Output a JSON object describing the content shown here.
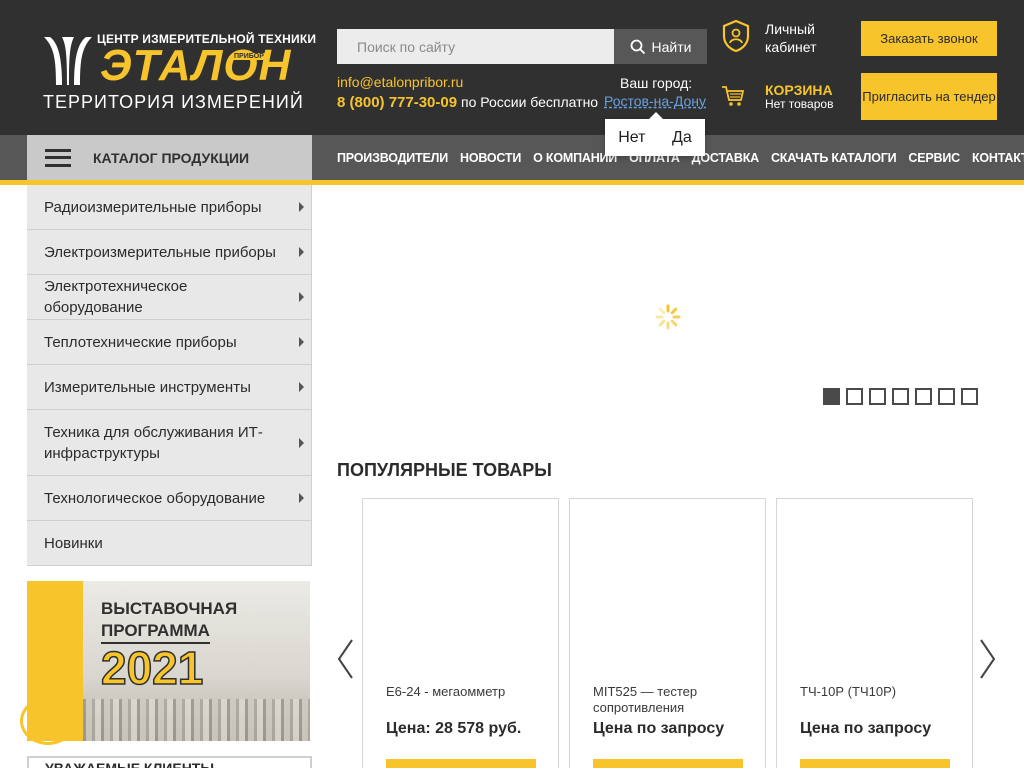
{
  "header": {
    "logo_top": "ЦЕНТР ИЗМЕРИТЕЛЬНОЙ ТЕХНИКИ",
    "logo_main": "ЭТАЛОН",
    "logo_badge": "ПРИБОР",
    "logo_tagline": "ТЕРРИТОРИЯ ИЗМЕРЕНИЙ",
    "search_placeholder": "Поиск по сайту",
    "search_button": "Найти",
    "email": "info@etalonpribor.ru",
    "phone": "8 (800) 777-30-09",
    "phone_note": " по России бесплатно",
    "city_label": "Ваш город:",
    "city": "Ростов-на-Дону",
    "city_confirm_no": "Нет",
    "city_confirm_yes": "Да",
    "cabinet": "Личный кабинет",
    "cart_title": "КОРЗИНА",
    "cart_status": "Нет товаров",
    "btn_call": "Заказать звонок",
    "btn_tender": "Пригласить на тендер"
  },
  "nav": {
    "catalog": "КАТАЛОГ ПРОДУКЦИИ",
    "items": [
      "ПРОИЗВОДИТЕЛИ",
      "НОВОСТИ",
      "О КОМПАНИИ",
      "ОПЛАТА",
      "ДОСТАВКА",
      "СКАЧАТЬ КАТАЛОГИ",
      "СЕРВИС",
      "КОНТАКТЫ"
    ]
  },
  "sidebar": {
    "items": [
      {
        "label": "Радиоизмерительные приборы",
        "has_children": true
      },
      {
        "label": "Электроизмерительные приборы",
        "has_children": true
      },
      {
        "label": "Электротехническое оборудование",
        "has_children": true
      },
      {
        "label": "Теплотехнические приборы",
        "has_children": true
      },
      {
        "label": "Измерительные инструменты",
        "has_children": true
      },
      {
        "label": "Техника для обслуживания ИТ-инфраструктуры",
        "has_children": true
      },
      {
        "label": "Технологическое оборудование",
        "has_children": true
      },
      {
        "label": "Новинки",
        "has_children": false
      }
    ]
  },
  "promo": {
    "line1": "ВЫСТАВОЧНАЯ",
    "line2": "ПРОГРАММА",
    "year": "2021"
  },
  "clients_heading": "УВАЖАЕМЫЕ КЛИЕНТЫ",
  "slider": {
    "slide_count": 7,
    "active_slide": 1
  },
  "popular": {
    "title": "ПОПУЛЯРНЫЕ ТОВАРЫ",
    "products": [
      {
        "name": "Е6-24 - мегаомметр",
        "price": "Цена: 28 578 руб."
      },
      {
        "name": "MIT525 — тестер сопротивления",
        "price": "Цена по запросу"
      },
      {
        "name": "ТЧ-10Р (ТЧ10Р)",
        "price": "Цена по запросу"
      }
    ]
  },
  "colors": {
    "accent": "#f7c42c",
    "header_bg": "#303030",
    "nav_bg": "#575757",
    "sidebar_bg": "#e8e8e8",
    "link": "#6aa0e0"
  }
}
